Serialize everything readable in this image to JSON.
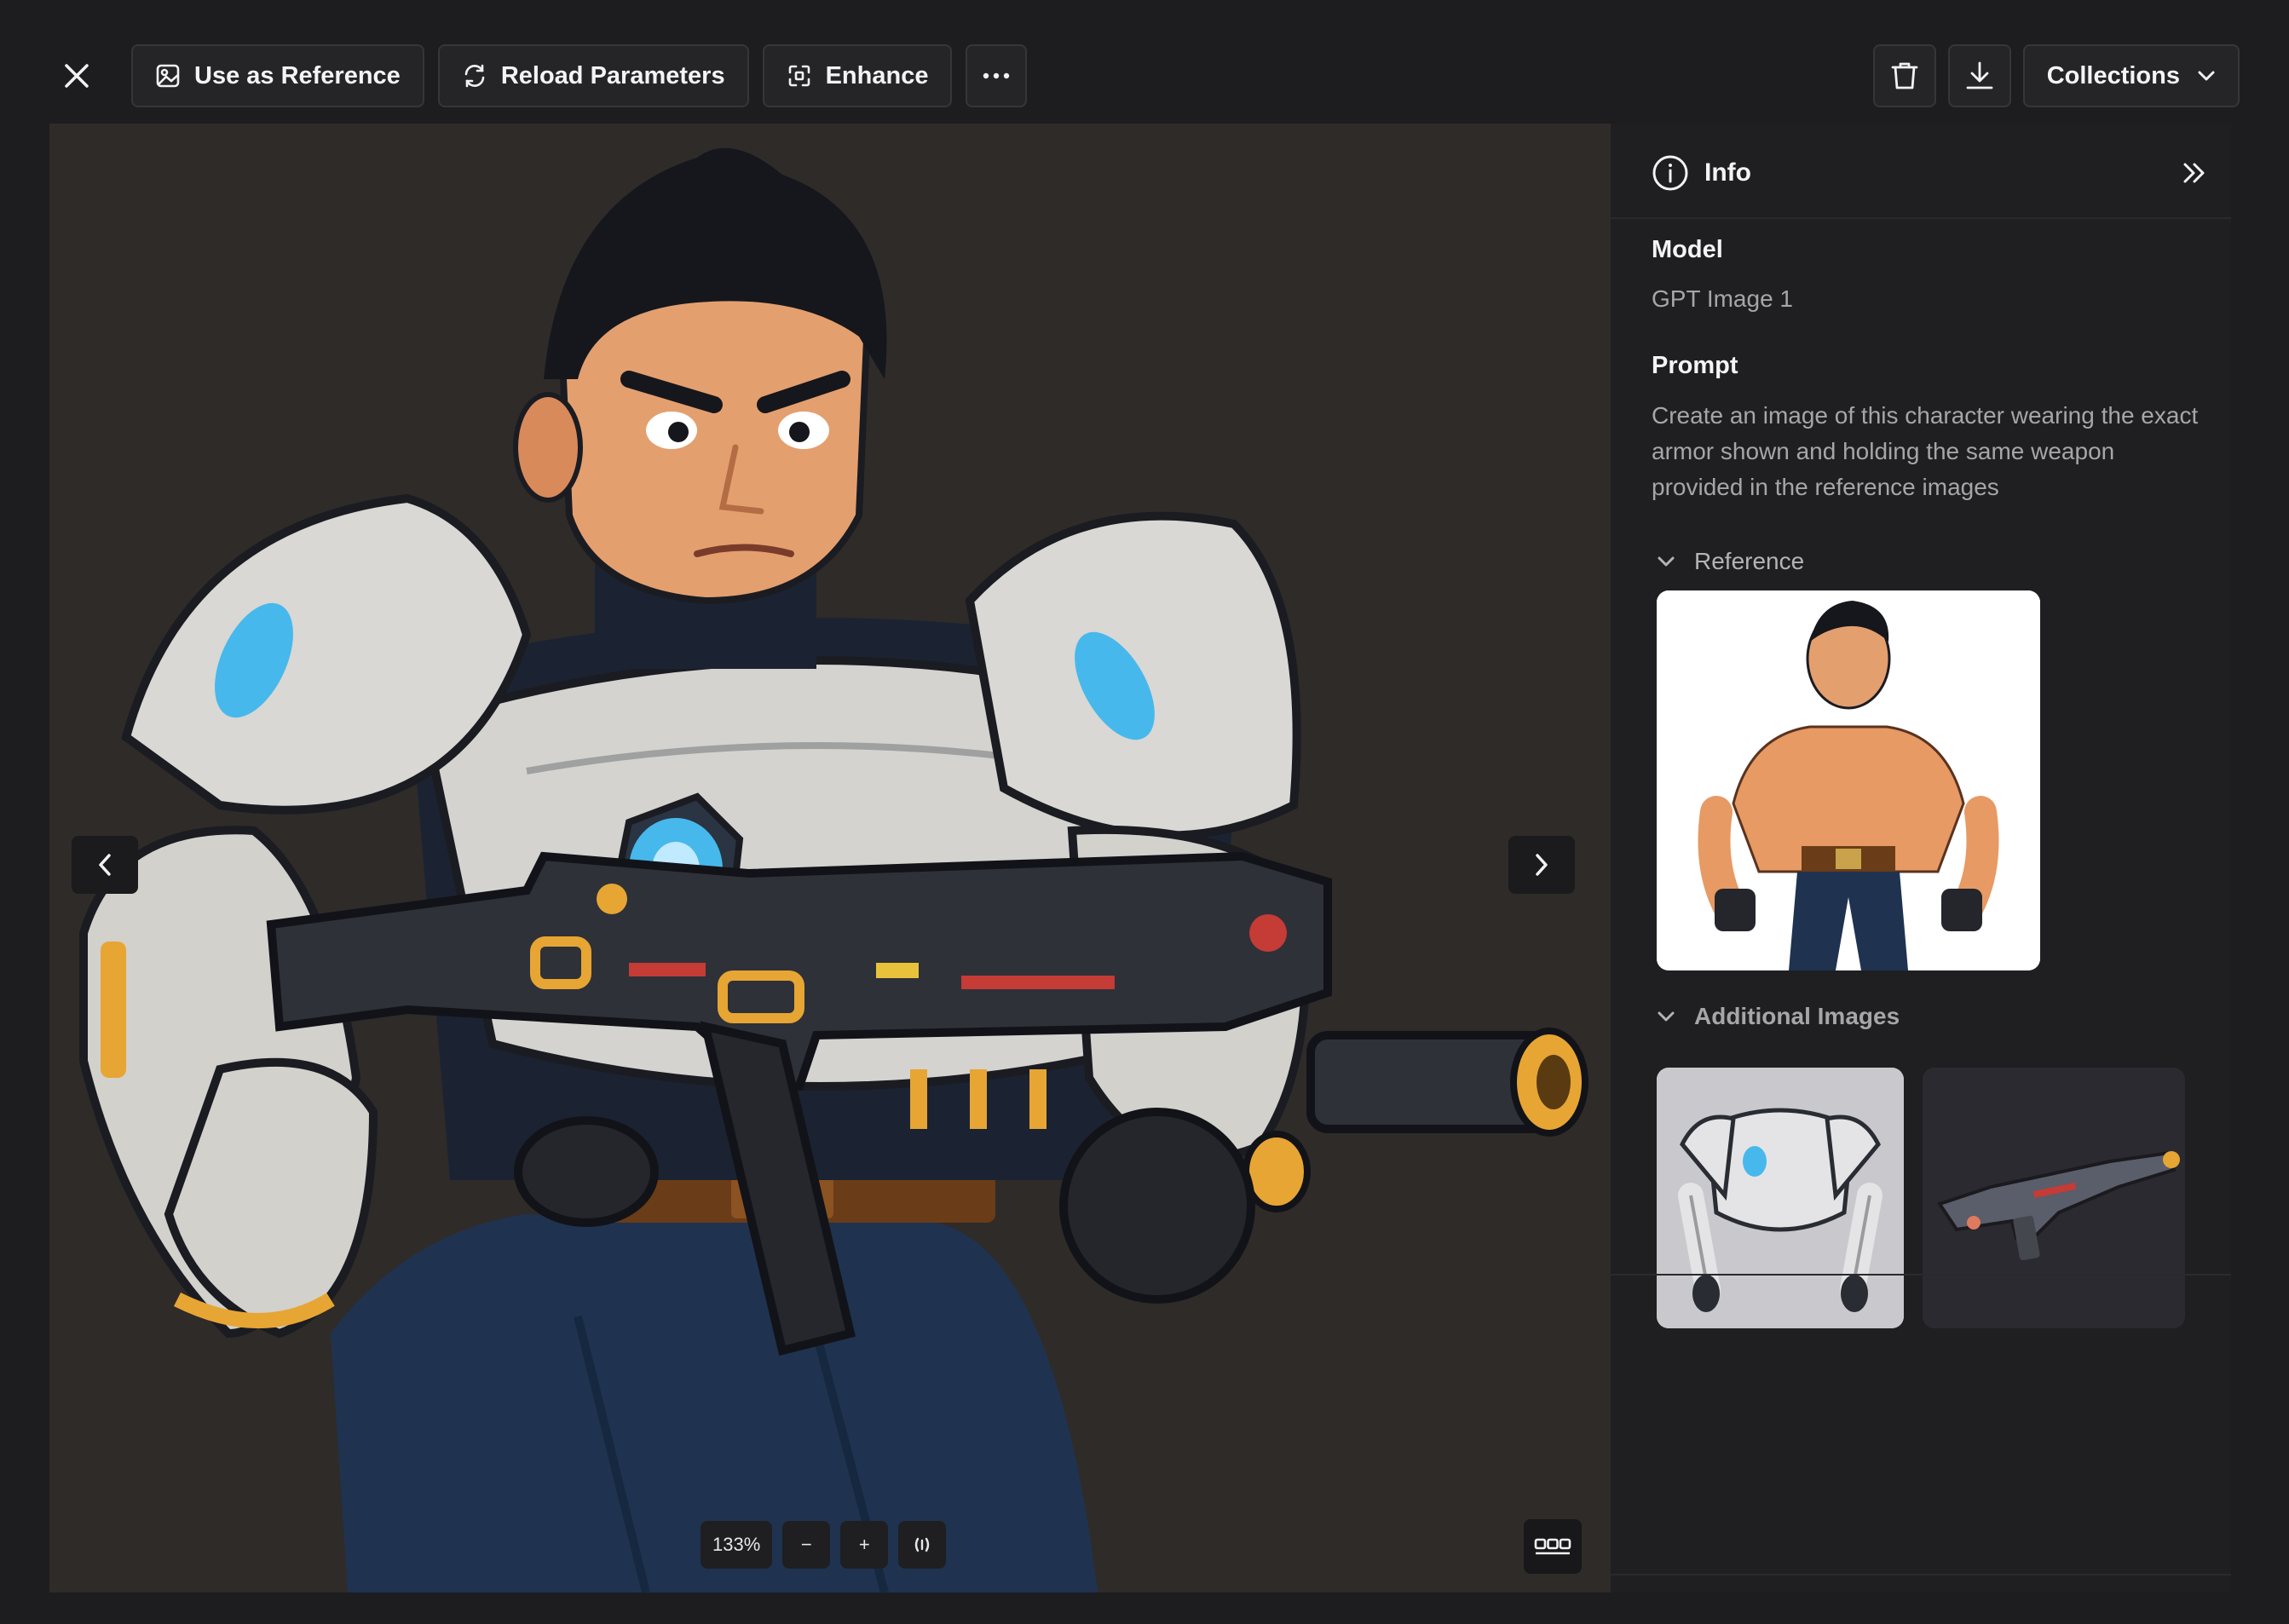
{
  "toolbar": {
    "use_as_reference": "Use as Reference",
    "reload_parameters": "Reload Parameters",
    "enhance": "Enhance",
    "collections": "Collections"
  },
  "viewer": {
    "zoom_level": "133%",
    "zoom_out": "−",
    "zoom_in": "+"
  },
  "info_panel": {
    "title": "Info",
    "model_label": "Model",
    "model_value": "GPT Image 1",
    "prompt_label": "Prompt",
    "prompt_value": "Create an image of this character wearing the exact armor shown and holding the same weapon provided in the reference images",
    "reference_label": "Reference",
    "additional_images_label": "Additional Images"
  },
  "icons": {
    "close": "close-icon",
    "reference": "image-icon",
    "reload": "refresh-icon",
    "enhance": "enhance-icon",
    "more": "more-horizontal-icon",
    "delete": "trash-icon",
    "download": "download-icon",
    "collections_caret": "chevron-down-icon",
    "info": "info-icon",
    "collapse_panel": "chevrons-right-icon",
    "prev": "chevron-left-icon",
    "next": "chevron-right-icon",
    "fit": "fit-width-icon",
    "gallery": "gallery-grid-icon"
  },
  "colors": {
    "background": "#1d1d1f",
    "canvas": "#2f2b29",
    "panel": "#1f1f21",
    "button_bg": "#252527",
    "muted_text": "#a6a6a9",
    "energy_glow": "#47b8ec",
    "accent_orange": "#e7a534"
  }
}
